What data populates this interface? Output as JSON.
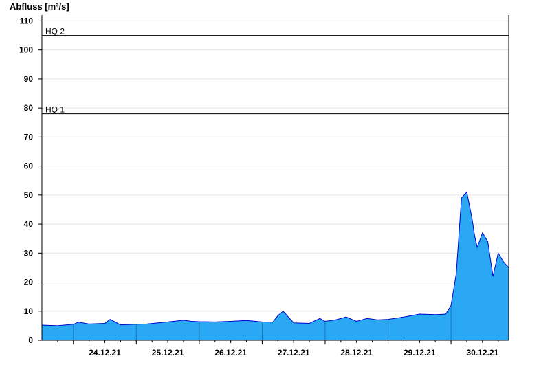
{
  "chart_data": {
    "type": "area",
    "ylabel": "Abfluss [m³/s]",
    "ylim": [
      0,
      112
    ],
    "yticks": [
      0,
      10,
      20,
      30,
      40,
      50,
      60,
      70,
      80,
      90,
      100,
      110
    ],
    "xlim": [
      "2021-12-23T12:00",
      "2021-12-30T22:00"
    ],
    "xtick_labels": [
      "24.12.21",
      "25.12.21",
      "26.12.21",
      "27.12.21",
      "28.12.21",
      "29.12.21",
      "30.12.21"
    ],
    "grid": true,
    "reference_lines": [
      {
        "name": "HQ 2",
        "value": 105
      },
      {
        "name": "HQ 1",
        "value": 78
      }
    ],
    "colors": {
      "fill": "#2aa8f4",
      "line": "#0000cc"
    },
    "series": [
      {
        "x": [
          "2021-12-23T12:00",
          "2021-12-23T18:00",
          "2021-12-24T00:00",
          "2021-12-24T02:00",
          "2021-12-24T06:00",
          "2021-12-24T12:00",
          "2021-12-24T14:00",
          "2021-12-24T18:00",
          "2021-12-25T00:00",
          "2021-12-25T04:00",
          "2021-12-25T12:00",
          "2021-12-25T18:00",
          "2021-12-25T21:00",
          "2021-12-26T00:00",
          "2021-12-26T06:00",
          "2021-12-26T12:00",
          "2021-12-26T18:00",
          "2021-12-27T00:00",
          "2021-12-27T04:00",
          "2021-12-27T06:00",
          "2021-12-27T08:00",
          "2021-12-27T12:00",
          "2021-12-27T18:00",
          "2021-12-27T22:00",
          "2021-12-28T00:00",
          "2021-12-28T04:00",
          "2021-12-28T08:00",
          "2021-12-28T12:00",
          "2021-12-28T16:00",
          "2021-12-28T20:00",
          "2021-12-29T00:00",
          "2021-12-29T06:00",
          "2021-12-29T12:00",
          "2021-12-29T18:00",
          "2021-12-29T22:00",
          "2021-12-30T00:00",
          "2021-12-30T02:00",
          "2021-12-30T04:00",
          "2021-12-30T06:00",
          "2021-12-30T08:00",
          "2021-12-30T09:00",
          "2021-12-30T10:00",
          "2021-12-30T12:00",
          "2021-12-30T14:00",
          "2021-12-30T16:00",
          "2021-12-30T18:00",
          "2021-12-30T20:00",
          "2021-12-30T22:00"
        ],
        "values": [
          5.2,
          5.0,
          5.5,
          6.2,
          5.6,
          5.8,
          7.2,
          5.3,
          5.5,
          5.6,
          6.3,
          6.9,
          6.5,
          6.4,
          6.3,
          6.5,
          6.8,
          6.3,
          6.2,
          8.5,
          10.0,
          6.0,
          5.8,
          7.5,
          6.5,
          7.0,
          8.0,
          6.5,
          7.5,
          7.0,
          7.2,
          8.0,
          9.0,
          8.8,
          9.0,
          12.0,
          23.0,
          49.0,
          51.0,
          42.0,
          36.0,
          32.0,
          37.0,
          34.0,
          22.0,
          30.0,
          27.0,
          25.0
        ]
      }
    ]
  }
}
